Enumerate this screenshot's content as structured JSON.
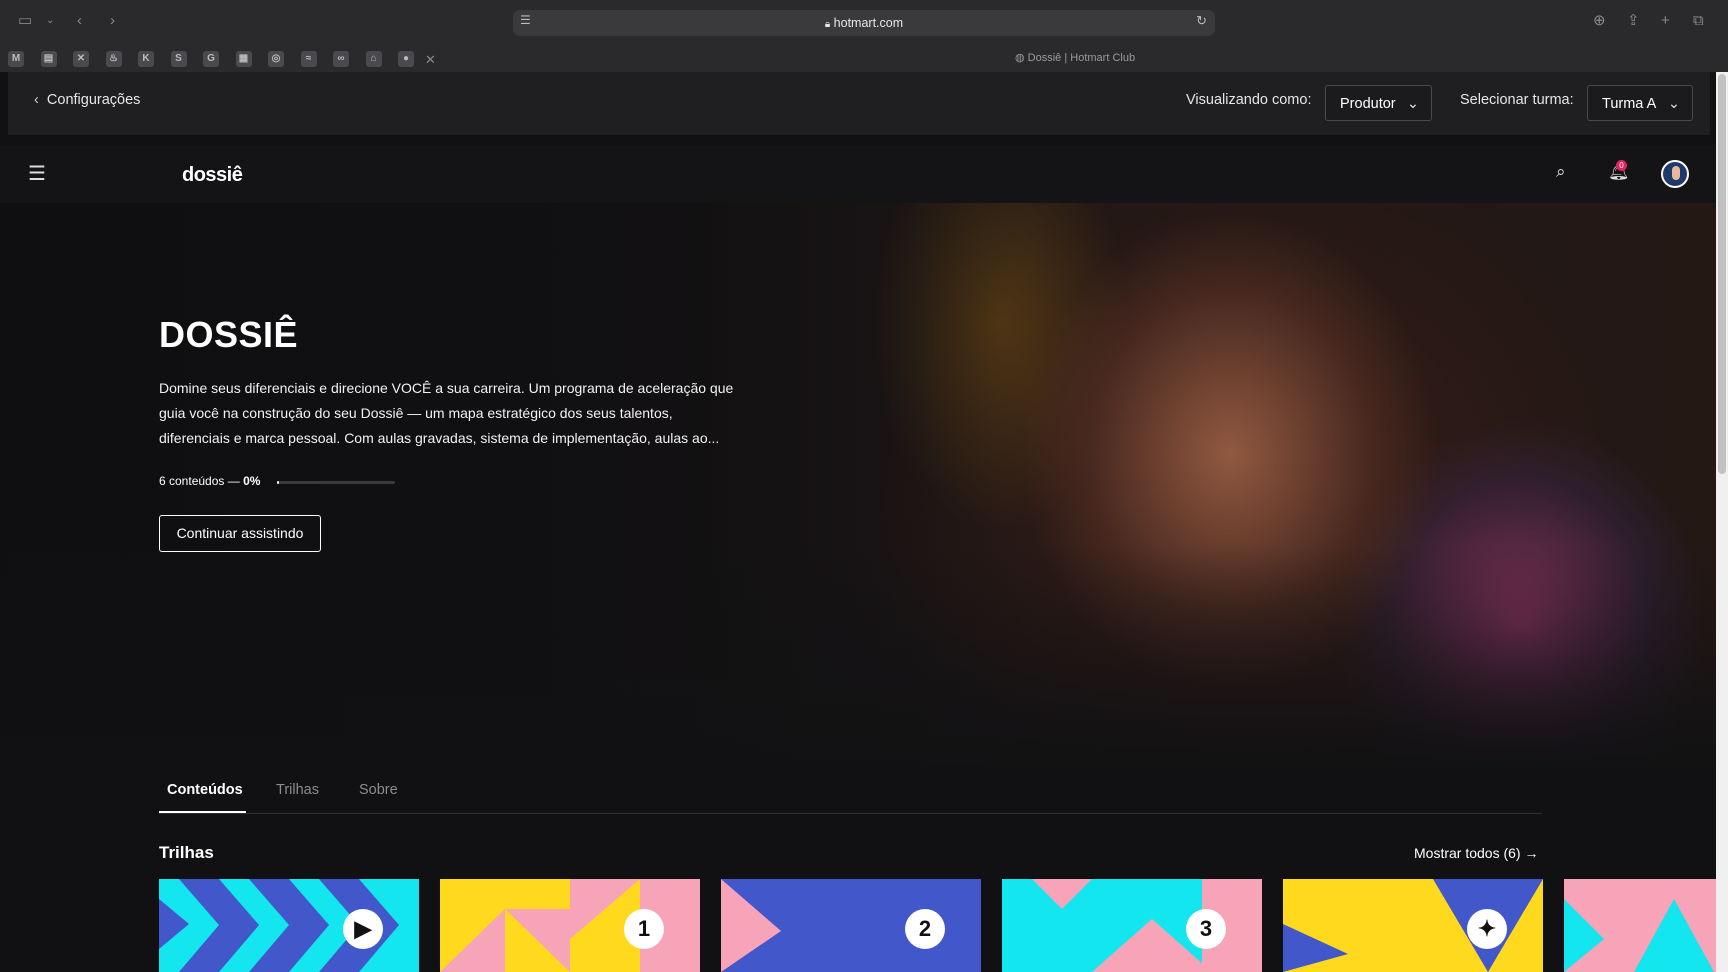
{
  "browser": {
    "url": "hotmart.com",
    "tab_title": "Dossiê | Hotmart Club",
    "favicons": [
      "M",
      "▤",
      "✕",
      "♨",
      "K",
      "S",
      "G",
      "▦",
      "◎",
      "≈",
      "∞",
      "⌂",
      "●"
    ]
  },
  "producer_bar": {
    "back_label": "Configurações",
    "viewing_as_label": "Visualizando como:",
    "viewing_as_value": "Produtor",
    "select_class_label": "Selecionar turma:",
    "select_class_value": "Turma A"
  },
  "header": {
    "logo": "dossiê",
    "notification_count": "0"
  },
  "hero": {
    "title": "DOSSIÊ",
    "description": "Domine seus diferenciais e direcione VOCÊ a sua carreira. Um programa de aceleração que guia você na construção do seu Dossiê — um mapa estratégico dos seus talentos, diferenciais e marca pessoal. Com aulas gravadas, sistema de implementação, aulas ao...",
    "contents_count": "6 conteúdos —",
    "progress_label": "0%",
    "progress_value": 0.02,
    "continue_button": "Continuar assistindo"
  },
  "tabs": [
    {
      "label": "Conteúdos",
      "active": true
    },
    {
      "label": "Trilhas",
      "active": false
    },
    {
      "label": "Sobre",
      "active": false
    }
  ],
  "section": {
    "title": "Trilhas",
    "show_all": "Mostrar todos (6) →"
  },
  "cards": [
    {
      "badge": "▶",
      "colors": [
        "#13e6ee",
        "#4257c9"
      ]
    },
    {
      "badge": "1",
      "colors": [
        "#ffd91e",
        "#f7a3b8"
      ]
    },
    {
      "badge": "2",
      "colors": [
        "#4257c9",
        "#f7a3b8"
      ]
    },
    {
      "badge": "3",
      "colors": [
        "#13e6ee",
        "#f7a3b8"
      ]
    },
    {
      "badge": "✦",
      "colors": [
        "#ffd91e",
        "#4257c9"
      ]
    },
    {
      "badge": "",
      "colors": [
        "#f7a3b8",
        "#13e6ee"
      ]
    }
  ]
}
